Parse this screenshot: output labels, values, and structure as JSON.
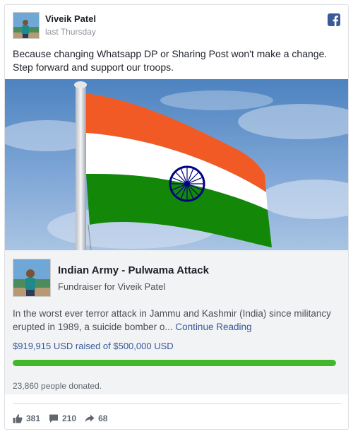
{
  "post": {
    "author": "Viveik Patel",
    "time": "last Thursday",
    "text_lines": [
      "Because changing Whatsapp DP or Sharing Post won't make a change.",
      "Step forward and support our troops."
    ]
  },
  "fundraiser": {
    "title": "Indian Army - Pulwama Attack",
    "subtitle": "Fundraiser for Viveik Patel",
    "description_line1": "In the worst ever terror attack in Jammu and Kashmir (India) since militancy",
    "description_line2": "erupted in 1989, a suicide bomber o...",
    "continue_label": "Continue Reading",
    "raised_text": "$919,915 USD raised of $500,000 USD",
    "progress_fraction": 1.0,
    "donated_text": "23,860 people donated."
  },
  "footer": {
    "likes": "381",
    "comments": "210",
    "shares": "68"
  },
  "colors": {
    "link": "#365899",
    "progress": "#42b72a",
    "facebook": "#3b5998",
    "saffron": "#f15a24",
    "india_green": "#138808",
    "chakra_navy": "#000080"
  },
  "icons": [
    "facebook-logo-icon",
    "like-icon",
    "comment-icon",
    "share-icon"
  ]
}
